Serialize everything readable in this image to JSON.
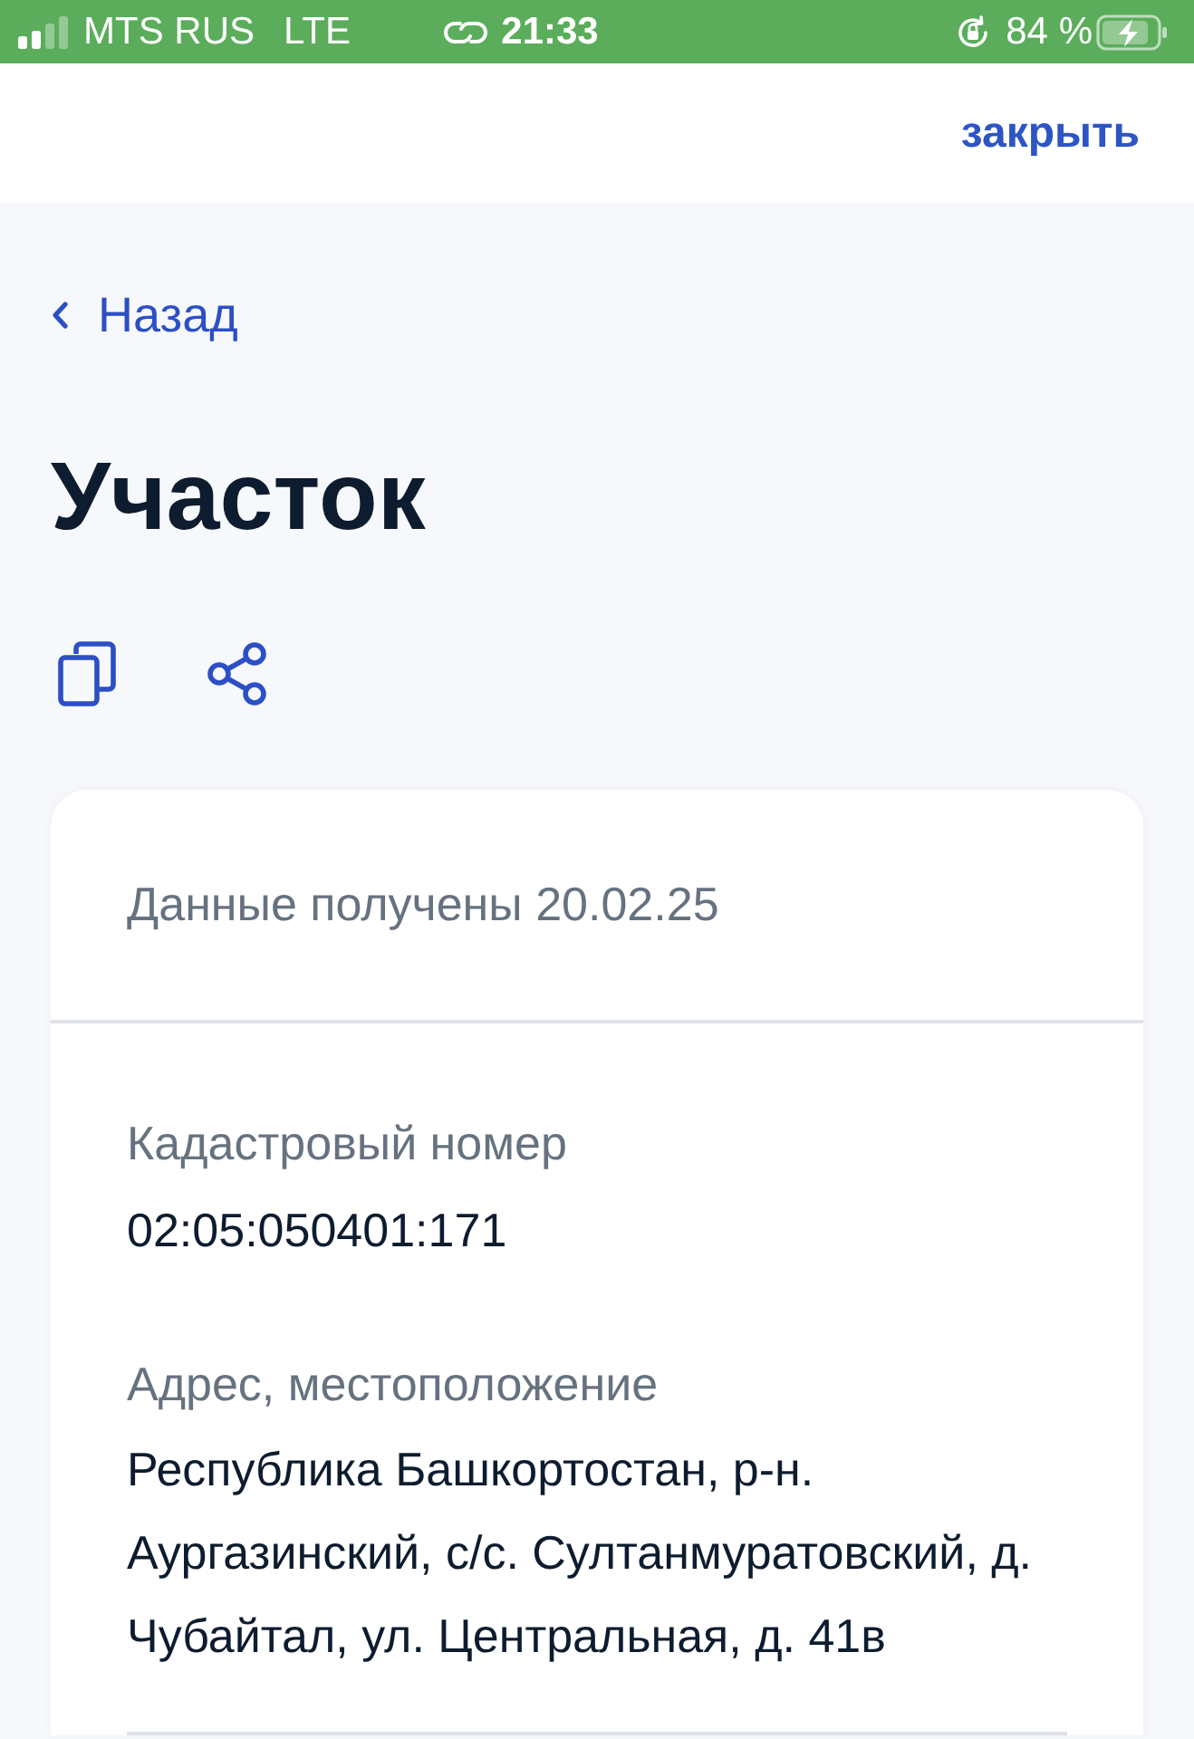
{
  "status_bar": {
    "carrier": "MTS RUS",
    "network": "LTE",
    "time": "21:33",
    "battery": "84 %"
  },
  "top_bar": {
    "close": "закрыть"
  },
  "back": {
    "label": "Назад"
  },
  "title": "Участок",
  "card": {
    "received": "Данные получены 20.02.25",
    "fields": [
      {
        "label": "Кадастровый номер",
        "value": "02:05:050401:171"
      },
      {
        "label": "Адрес, местоположение",
        "value": "Республика Башкортостан, р-н. Аургазинский, с/с. Султанмуратовский, д. Чубайтал, ул. Центральная, д. 41в"
      }
    ]
  }
}
